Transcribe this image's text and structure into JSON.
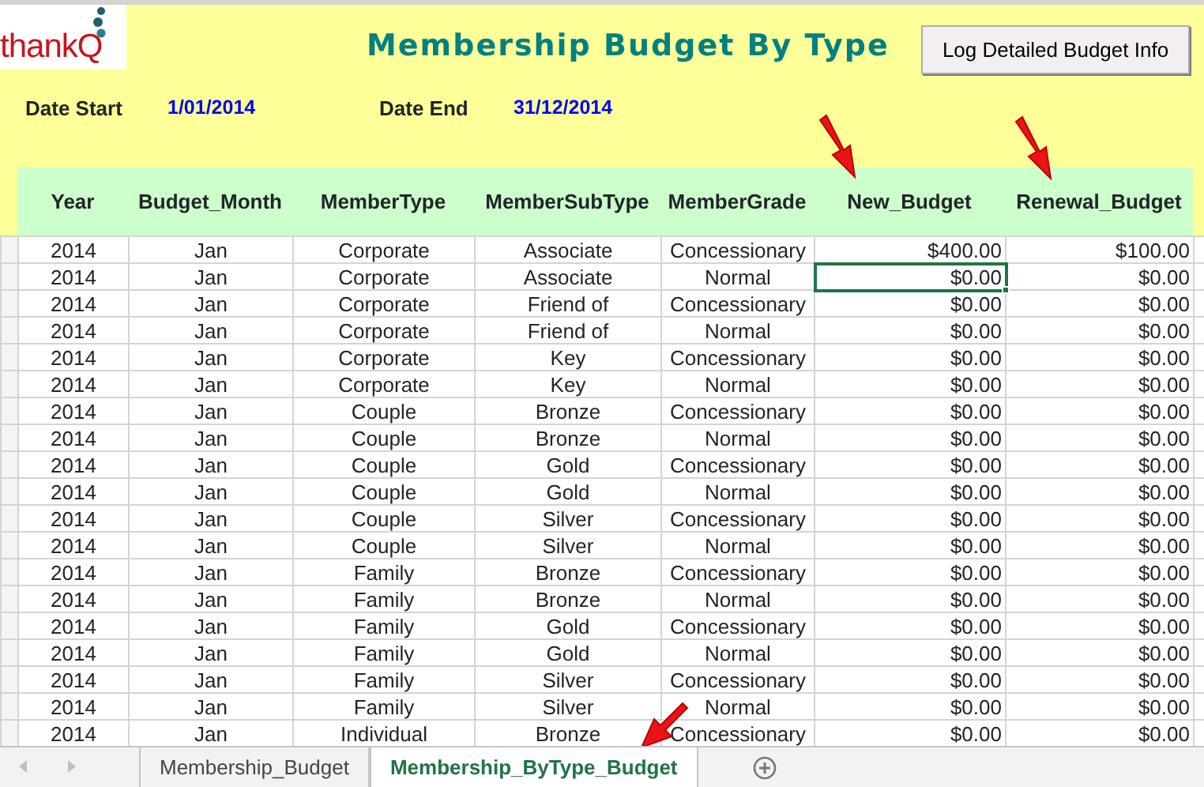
{
  "logo": "thankQ",
  "title": "Membership Budget By Type",
  "action_button": "Log Detailed Budget Info",
  "date_start": {
    "label": "Date Start",
    "value": "1/01/2014"
  },
  "date_end": {
    "label": "Date End",
    "value": "31/12/2014"
  },
  "table": {
    "columns": [
      "Year",
      "Budget_Month",
      "MemberType",
      "MemberSubType",
      "MemberGrade",
      "New_Budget",
      "Renewal_Budget"
    ],
    "rows": [
      {
        "cells": [
          {
            "text": "2014",
            "selected": false
          },
          {
            "text": "Jan",
            "selected": false
          },
          {
            "text": "Corporate",
            "selected": false
          },
          {
            "text": "Associate",
            "selected": false
          },
          {
            "text": "Concessionary",
            "selected": false
          },
          {
            "text": "$400.00",
            "selected": false
          },
          {
            "text": "$100.00",
            "selected": false
          }
        ]
      },
      {
        "cells": [
          {
            "text": "2014",
            "selected": false
          },
          {
            "text": "Jan",
            "selected": false
          },
          {
            "text": "Corporate",
            "selected": false
          },
          {
            "text": "Associate",
            "selected": false
          },
          {
            "text": "Normal",
            "selected": false
          },
          {
            "text": "$0.00",
            "selected": true
          },
          {
            "text": "$0.00",
            "selected": false
          }
        ]
      },
      {
        "cells": [
          {
            "text": "2014",
            "selected": false
          },
          {
            "text": "Jan",
            "selected": false
          },
          {
            "text": "Corporate",
            "selected": false
          },
          {
            "text": "Friend of",
            "selected": false
          },
          {
            "text": "Concessionary",
            "selected": false
          },
          {
            "text": "$0.00",
            "selected": false
          },
          {
            "text": "$0.00",
            "selected": false
          }
        ]
      },
      {
        "cells": [
          {
            "text": "2014",
            "selected": false
          },
          {
            "text": "Jan",
            "selected": false
          },
          {
            "text": "Corporate",
            "selected": false
          },
          {
            "text": "Friend of",
            "selected": false
          },
          {
            "text": "Normal",
            "selected": false
          },
          {
            "text": "$0.00",
            "selected": false
          },
          {
            "text": "$0.00",
            "selected": false
          }
        ]
      },
      {
        "cells": [
          {
            "text": "2014",
            "selected": false
          },
          {
            "text": "Jan",
            "selected": false
          },
          {
            "text": "Corporate",
            "selected": false
          },
          {
            "text": "Key",
            "selected": false
          },
          {
            "text": "Concessionary",
            "selected": false
          },
          {
            "text": "$0.00",
            "selected": false
          },
          {
            "text": "$0.00",
            "selected": false
          }
        ]
      },
      {
        "cells": [
          {
            "text": "2014",
            "selected": false
          },
          {
            "text": "Jan",
            "selected": false
          },
          {
            "text": "Corporate",
            "selected": false
          },
          {
            "text": "Key",
            "selected": false
          },
          {
            "text": "Normal",
            "selected": false
          },
          {
            "text": "$0.00",
            "selected": false
          },
          {
            "text": "$0.00",
            "selected": false
          }
        ]
      },
      {
        "cells": [
          {
            "text": "2014",
            "selected": false
          },
          {
            "text": "Jan",
            "selected": false
          },
          {
            "text": "Couple",
            "selected": false
          },
          {
            "text": "Bronze",
            "selected": false
          },
          {
            "text": "Concessionary",
            "selected": false
          },
          {
            "text": "$0.00",
            "selected": false
          },
          {
            "text": "$0.00",
            "selected": false
          }
        ]
      },
      {
        "cells": [
          {
            "text": "2014",
            "selected": false
          },
          {
            "text": "Jan",
            "selected": false
          },
          {
            "text": "Couple",
            "selected": false
          },
          {
            "text": "Bronze",
            "selected": false
          },
          {
            "text": "Normal",
            "selected": false
          },
          {
            "text": "$0.00",
            "selected": false
          },
          {
            "text": "$0.00",
            "selected": false
          }
        ]
      },
      {
        "cells": [
          {
            "text": "2014",
            "selected": false
          },
          {
            "text": "Jan",
            "selected": false
          },
          {
            "text": "Couple",
            "selected": false
          },
          {
            "text": "Gold",
            "selected": false
          },
          {
            "text": "Concessionary",
            "selected": false
          },
          {
            "text": "$0.00",
            "selected": false
          },
          {
            "text": "$0.00",
            "selected": false
          }
        ]
      },
      {
        "cells": [
          {
            "text": "2014",
            "selected": false
          },
          {
            "text": "Jan",
            "selected": false
          },
          {
            "text": "Couple",
            "selected": false
          },
          {
            "text": "Gold",
            "selected": false
          },
          {
            "text": "Normal",
            "selected": false
          },
          {
            "text": "$0.00",
            "selected": false
          },
          {
            "text": "$0.00",
            "selected": false
          }
        ]
      },
      {
        "cells": [
          {
            "text": "2014",
            "selected": false
          },
          {
            "text": "Jan",
            "selected": false
          },
          {
            "text": "Couple",
            "selected": false
          },
          {
            "text": "Silver",
            "selected": false
          },
          {
            "text": "Concessionary",
            "selected": false
          },
          {
            "text": "$0.00",
            "selected": false
          },
          {
            "text": "$0.00",
            "selected": false
          }
        ]
      },
      {
        "cells": [
          {
            "text": "2014",
            "selected": false
          },
          {
            "text": "Jan",
            "selected": false
          },
          {
            "text": "Couple",
            "selected": false
          },
          {
            "text": "Silver",
            "selected": false
          },
          {
            "text": "Normal",
            "selected": false
          },
          {
            "text": "$0.00",
            "selected": false
          },
          {
            "text": "$0.00",
            "selected": false
          }
        ]
      },
      {
        "cells": [
          {
            "text": "2014",
            "selected": false
          },
          {
            "text": "Jan",
            "selected": false
          },
          {
            "text": "Family",
            "selected": false
          },
          {
            "text": "Bronze",
            "selected": false
          },
          {
            "text": "Concessionary",
            "selected": false
          },
          {
            "text": "$0.00",
            "selected": false
          },
          {
            "text": "$0.00",
            "selected": false
          }
        ]
      },
      {
        "cells": [
          {
            "text": "2014",
            "selected": false
          },
          {
            "text": "Jan",
            "selected": false
          },
          {
            "text": "Family",
            "selected": false
          },
          {
            "text": "Bronze",
            "selected": false
          },
          {
            "text": "Normal",
            "selected": false
          },
          {
            "text": "$0.00",
            "selected": false
          },
          {
            "text": "$0.00",
            "selected": false
          }
        ]
      },
      {
        "cells": [
          {
            "text": "2014",
            "selected": false
          },
          {
            "text": "Jan",
            "selected": false
          },
          {
            "text": "Family",
            "selected": false
          },
          {
            "text": "Gold",
            "selected": false
          },
          {
            "text": "Concessionary",
            "selected": false
          },
          {
            "text": "$0.00",
            "selected": false
          },
          {
            "text": "$0.00",
            "selected": false
          }
        ]
      },
      {
        "cells": [
          {
            "text": "2014",
            "selected": false
          },
          {
            "text": "Jan",
            "selected": false
          },
          {
            "text": "Family",
            "selected": false
          },
          {
            "text": "Gold",
            "selected": false
          },
          {
            "text": "Normal",
            "selected": false
          },
          {
            "text": "$0.00",
            "selected": false
          },
          {
            "text": "$0.00",
            "selected": false
          }
        ]
      },
      {
        "cells": [
          {
            "text": "2014",
            "selected": false
          },
          {
            "text": "Jan",
            "selected": false
          },
          {
            "text": "Family",
            "selected": false
          },
          {
            "text": "Silver",
            "selected": false
          },
          {
            "text": "Concessionary",
            "selected": false
          },
          {
            "text": "$0.00",
            "selected": false
          },
          {
            "text": "$0.00",
            "selected": false
          }
        ]
      },
      {
        "cells": [
          {
            "text": "2014",
            "selected": false
          },
          {
            "text": "Jan",
            "selected": false
          },
          {
            "text": "Family",
            "selected": false
          },
          {
            "text": "Silver",
            "selected": false
          },
          {
            "text": "Normal",
            "selected": false
          },
          {
            "text": "$0.00",
            "selected": false
          },
          {
            "text": "$0.00",
            "selected": false
          }
        ]
      },
      {
        "cells": [
          {
            "text": "2014",
            "selected": false
          },
          {
            "text": "Jan",
            "selected": false
          },
          {
            "text": "Individual",
            "selected": false
          },
          {
            "text": "Bronze",
            "selected": false
          },
          {
            "text": "Concessionary",
            "selected": false
          },
          {
            "text": "$0.00",
            "selected": false
          },
          {
            "text": "$0.00",
            "selected": false
          }
        ]
      }
    ]
  },
  "sheet_tabs": [
    {
      "label": "Membership_Budget",
      "selected": false
    },
    {
      "label": "Membership_ByType_Budget",
      "selected": true
    }
  ]
}
